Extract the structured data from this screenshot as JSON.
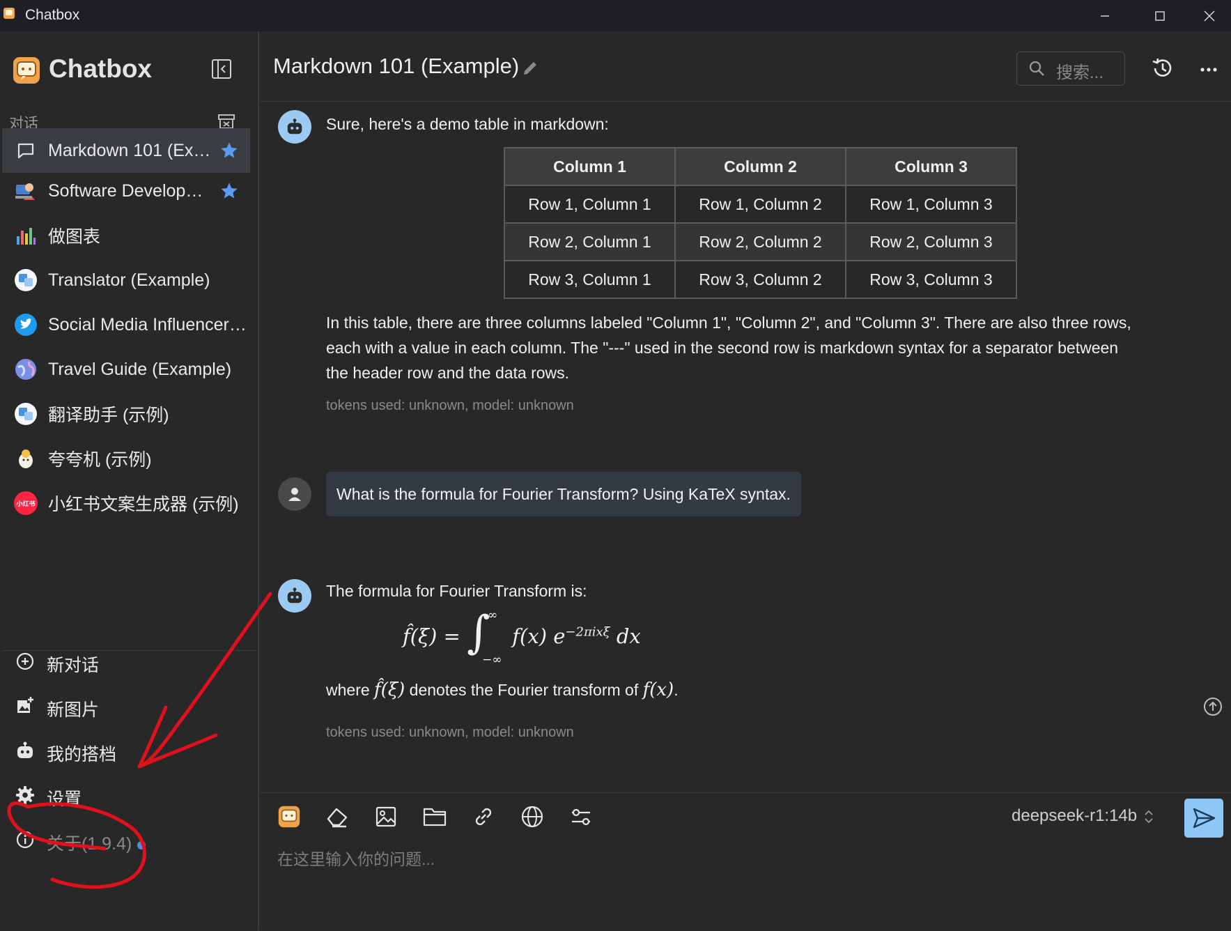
{
  "window": {
    "title": "Chatbox",
    "controls": [
      "minimize-icon",
      "maximize-icon",
      "close-icon"
    ]
  },
  "sidebar": {
    "brand": "Chatbox",
    "section_label": "对话",
    "conversations": [
      {
        "label": "Markdown 101 (Ex…",
        "icon": "chat-bubble-icon",
        "starred": true,
        "active": true
      },
      {
        "label": "Software Develop…",
        "icon": "developer-avatar-icon",
        "starred": true
      },
      {
        "label": "做图表",
        "icon": "chart-avatar-icon"
      },
      {
        "label": "Translator (Example)",
        "icon": "translate-avatar-icon"
      },
      {
        "label": "Social Media Influencer …",
        "icon": "twitter-avatar-icon"
      },
      {
        "label": "Travel Guide (Example)",
        "icon": "globe-avatar-icon"
      },
      {
        "label": "翻译助手 (示例)",
        "icon": "translate-avatar-icon"
      },
      {
        "label": "夸夸机 (示例)",
        "icon": "cheer-avatar-icon"
      },
      {
        "label": "小红书文案生成器 (示例)",
        "icon": "xiaohongshu-avatar-icon",
        "icon_text": "小红书"
      }
    ],
    "menu": {
      "new_chat": "新对话",
      "new_image": "新图片",
      "my_copilots": "我的搭档",
      "settings": "设置",
      "about": "关于(1.9.4)"
    }
  },
  "header": {
    "title": "Markdown 101 (Example)",
    "search_placeholder": "搜索..."
  },
  "messages": {
    "m1": {
      "intro": "Sure, here's a demo table in markdown:",
      "table": {
        "headers": [
          "Column 1",
          "Column 2",
          "Column 3"
        ],
        "rows": [
          [
            "Row 1, Column 1",
            "Row 1, Column 2",
            "Row 1, Column 3"
          ],
          [
            "Row 2, Column 1",
            "Row 2, Column 2",
            "Row 2, Column 3"
          ],
          [
            "Row 3, Column 1",
            "Row 3, Column 2",
            "Row 3, Column 3"
          ]
        ]
      },
      "body_lines": [
        "In this table, there are three columns labeled \"Column 1\", \"Column 2\", and \"Column 3\". There are also three rows,",
        "each with a value in each column. The \"---\" used in the second row is markdown syntax for a separator between",
        "the header row and the data rows."
      ],
      "meta": "tokens used: unknown, model: unknown"
    },
    "m2": {
      "text": "What is the formula for Fourier Transform? Using KaTeX syntax."
    },
    "m3": {
      "intro": "The formula for Fourier Transform is:",
      "formula": {
        "lhs": "f̂(ξ) =",
        "upper": "∞",
        "lower": "−∞",
        "integrand": "f(x) e",
        "exponent": "−2πixξ",
        "dx": "dx"
      },
      "where_parts": [
        "where ",
        "f̂(ξ)",
        " denotes the Fourier transform of ",
        "f(x)",
        "."
      ],
      "meta": "tokens used: unknown, model: unknown"
    }
  },
  "composer": {
    "tools": [
      "chatbox-logo-icon",
      "eraser-icon",
      "image-icon",
      "folder-icon",
      "link-icon",
      "globe-icon",
      "sliders-icon"
    ],
    "model": "deepseek-r1:14b",
    "placeholder": "在这里输入你的问题..."
  },
  "colors": {
    "bot_avatar": "#9ccaf2",
    "send_button": "#8ec7f5",
    "annotation_red": "#e0101c",
    "star": "#5b9cf2"
  }
}
